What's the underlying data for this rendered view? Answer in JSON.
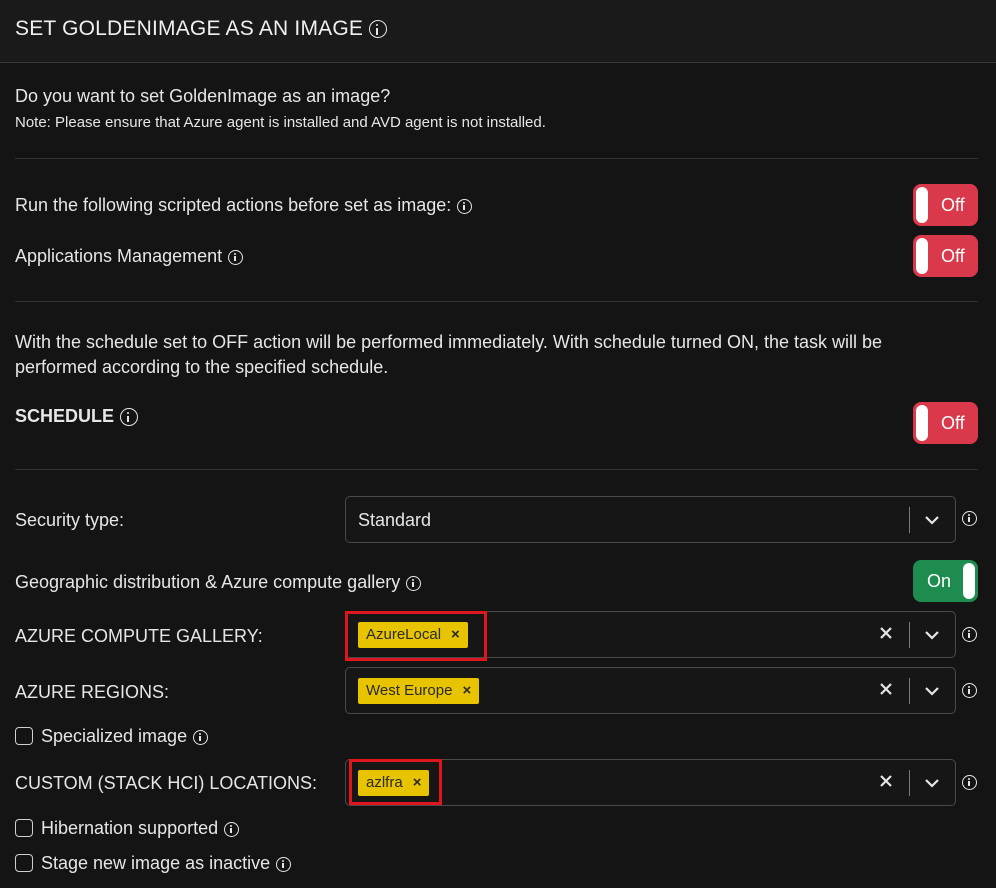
{
  "header": {
    "title": "SET GOLDENIMAGE AS AN IMAGE",
    "info_icon": "info-icon"
  },
  "intro": {
    "question": "Do you want to set GoldenImage as an image?",
    "note": "Note: Please ensure that Azure agent is installed and AVD agent is not installed."
  },
  "scripted_actions": {
    "label": "Run the following scripted actions before set as image:",
    "toggle": "Off"
  },
  "applications_management": {
    "label": "Applications Management",
    "toggle": "Off"
  },
  "schedule": {
    "description": "With the schedule set to OFF action will be performed immediately. With schedule turned ON, the task will be performed according to the specified schedule.",
    "label": "SCHEDULE",
    "toggle": "Off"
  },
  "security_type": {
    "label": "Security type:",
    "value": "Standard"
  },
  "geo_distribution": {
    "label": "Geographic distribution & Azure compute gallery",
    "toggle": "On"
  },
  "azure_compute_gallery": {
    "label": "AZURE COMPUTE GALLERY:",
    "chips": [
      "AzureLocal"
    ]
  },
  "azure_regions": {
    "label": "AZURE REGIONS:",
    "chips": [
      "West Europe"
    ]
  },
  "specialized_image": {
    "label": "Specialized image",
    "checked": false
  },
  "custom_locations": {
    "label": "CUSTOM (STACK HCI) LOCATIONS:",
    "chips": [
      "azlfra"
    ]
  },
  "hibernation": {
    "label": "Hibernation supported",
    "checked": false
  },
  "stage_inactive": {
    "label": "Stage new image as inactive",
    "checked": false
  },
  "colors": {
    "toggle_off": "#d9394a",
    "toggle_on": "#1e8c4e",
    "chip": "#e8c400",
    "highlight": "#e0161f"
  }
}
